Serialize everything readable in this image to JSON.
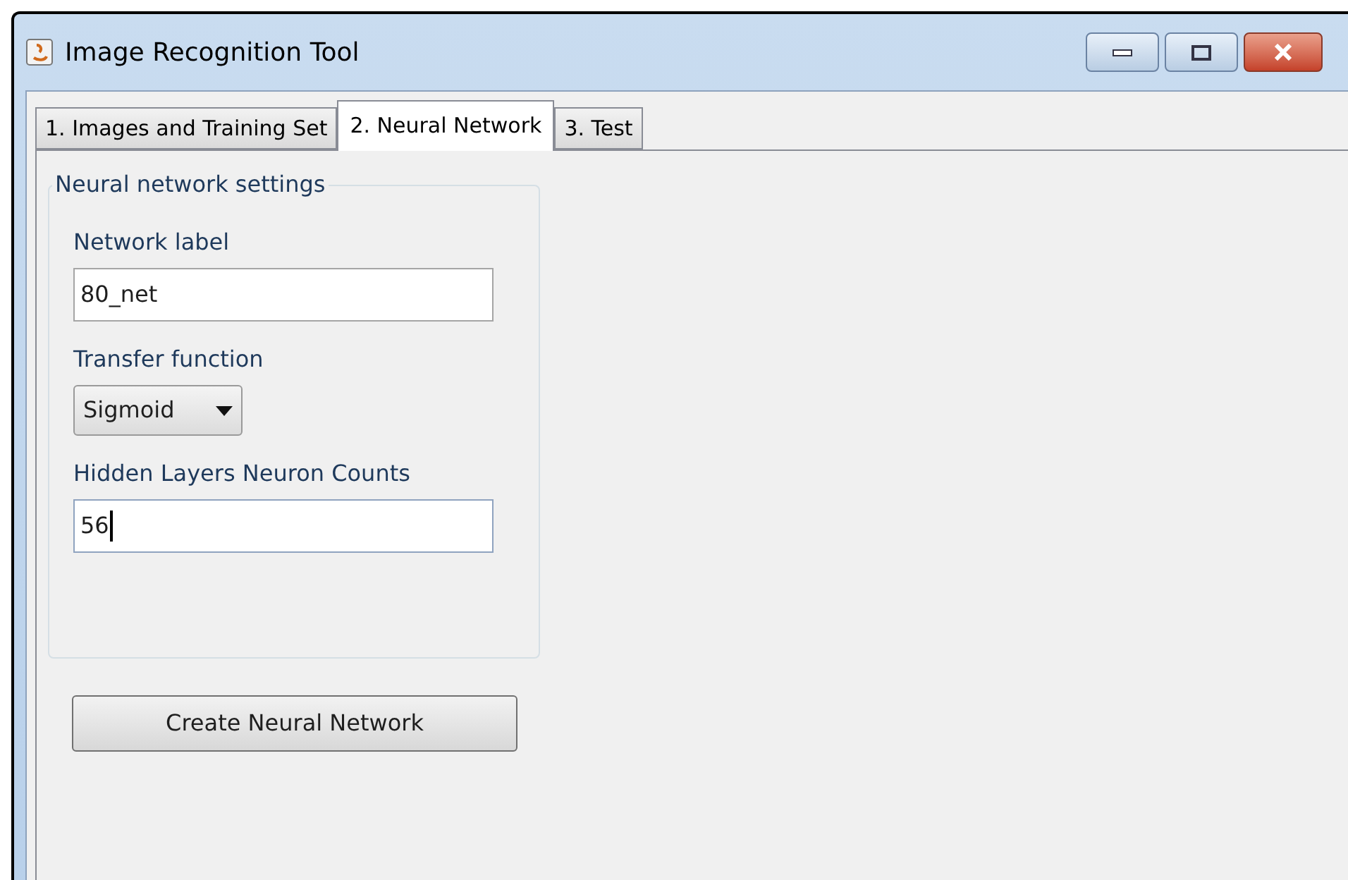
{
  "window": {
    "title": "Image Recognition Tool"
  },
  "tabs": [
    {
      "label": "1. Images and Training Set",
      "selected": false
    },
    {
      "label": "2. Neural Network",
      "selected": true
    },
    {
      "label": "3. Test",
      "selected": false
    }
  ],
  "group": {
    "title": "Neural network settings",
    "fields": [
      {
        "kind": "text",
        "label": "Network label",
        "value": "80_net",
        "focused": false
      },
      {
        "kind": "dropdown",
        "label": "Transfer function",
        "value": "Sigmoid"
      },
      {
        "kind": "text",
        "label": "Hidden Layers Neuron Counts",
        "value": "56",
        "focused": true
      }
    ]
  },
  "button": {
    "label": "Create Neural Network"
  }
}
